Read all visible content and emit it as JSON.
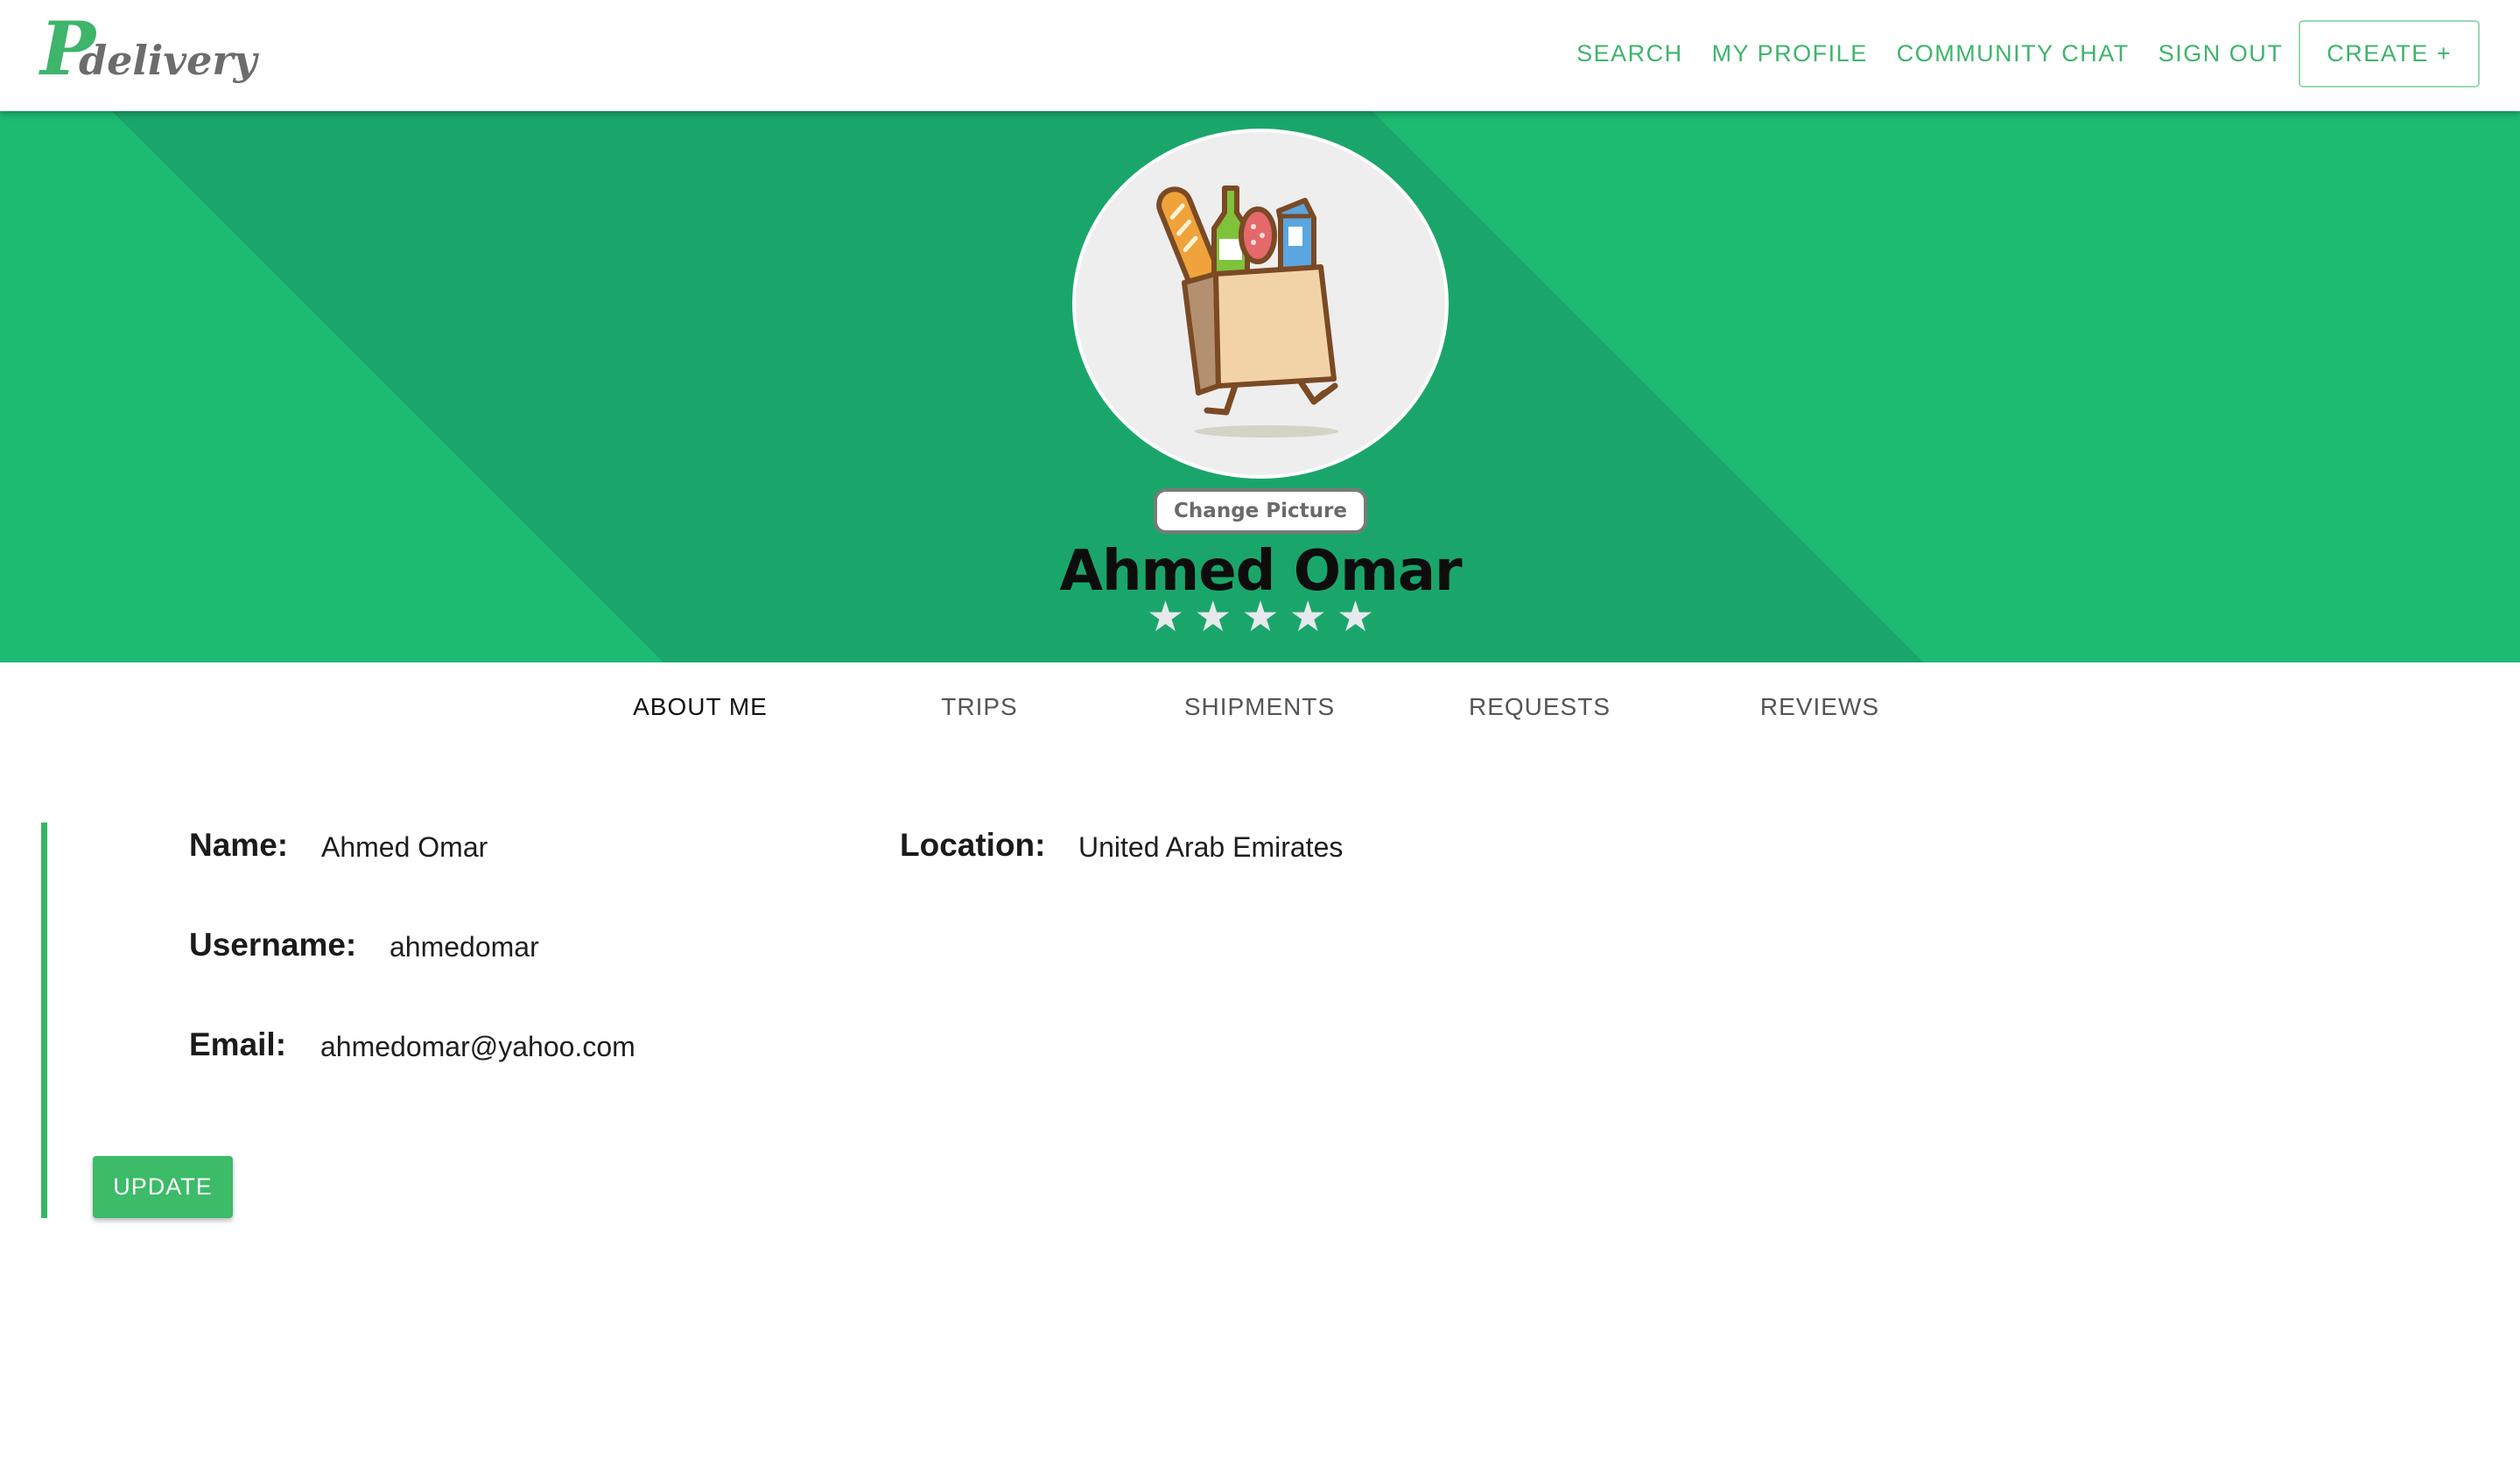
{
  "brand": {
    "logo_letter": "P",
    "logo_word": "delivery"
  },
  "nav": {
    "search": "SEARCH",
    "my_profile": "MY PROFILE",
    "community_chat": "COMMUNITY CHAT",
    "sign_out": "SIGN OUT",
    "create": "CREATE +"
  },
  "profile": {
    "change_picture": "Change Picture",
    "name": "Ahmed Omar",
    "rating": {
      "stars_shown": 5,
      "filled": 0
    },
    "avatar_icon": "grocery-bag-running-icon"
  },
  "tabs": [
    "ABOUT ME",
    "TRIPS",
    "SHIPMENTS",
    "REQUESTS",
    "REVIEWS"
  ],
  "about": {
    "name_label": "Name:",
    "name_value": "Ahmed Omar",
    "location_label": "Location:",
    "location_value": "United Arab Emirates",
    "username_label": "Username:",
    "username_value": "ahmedomar",
    "email_label": "Email:",
    "email_value": "ahmedomar@yahoo.com",
    "update_button": "UPDATE"
  },
  "colors": {
    "accent": "#3fb46b",
    "hero_light": "#1dba73",
    "hero_dark": "#1aa66b",
    "star": "#e6eaec"
  }
}
